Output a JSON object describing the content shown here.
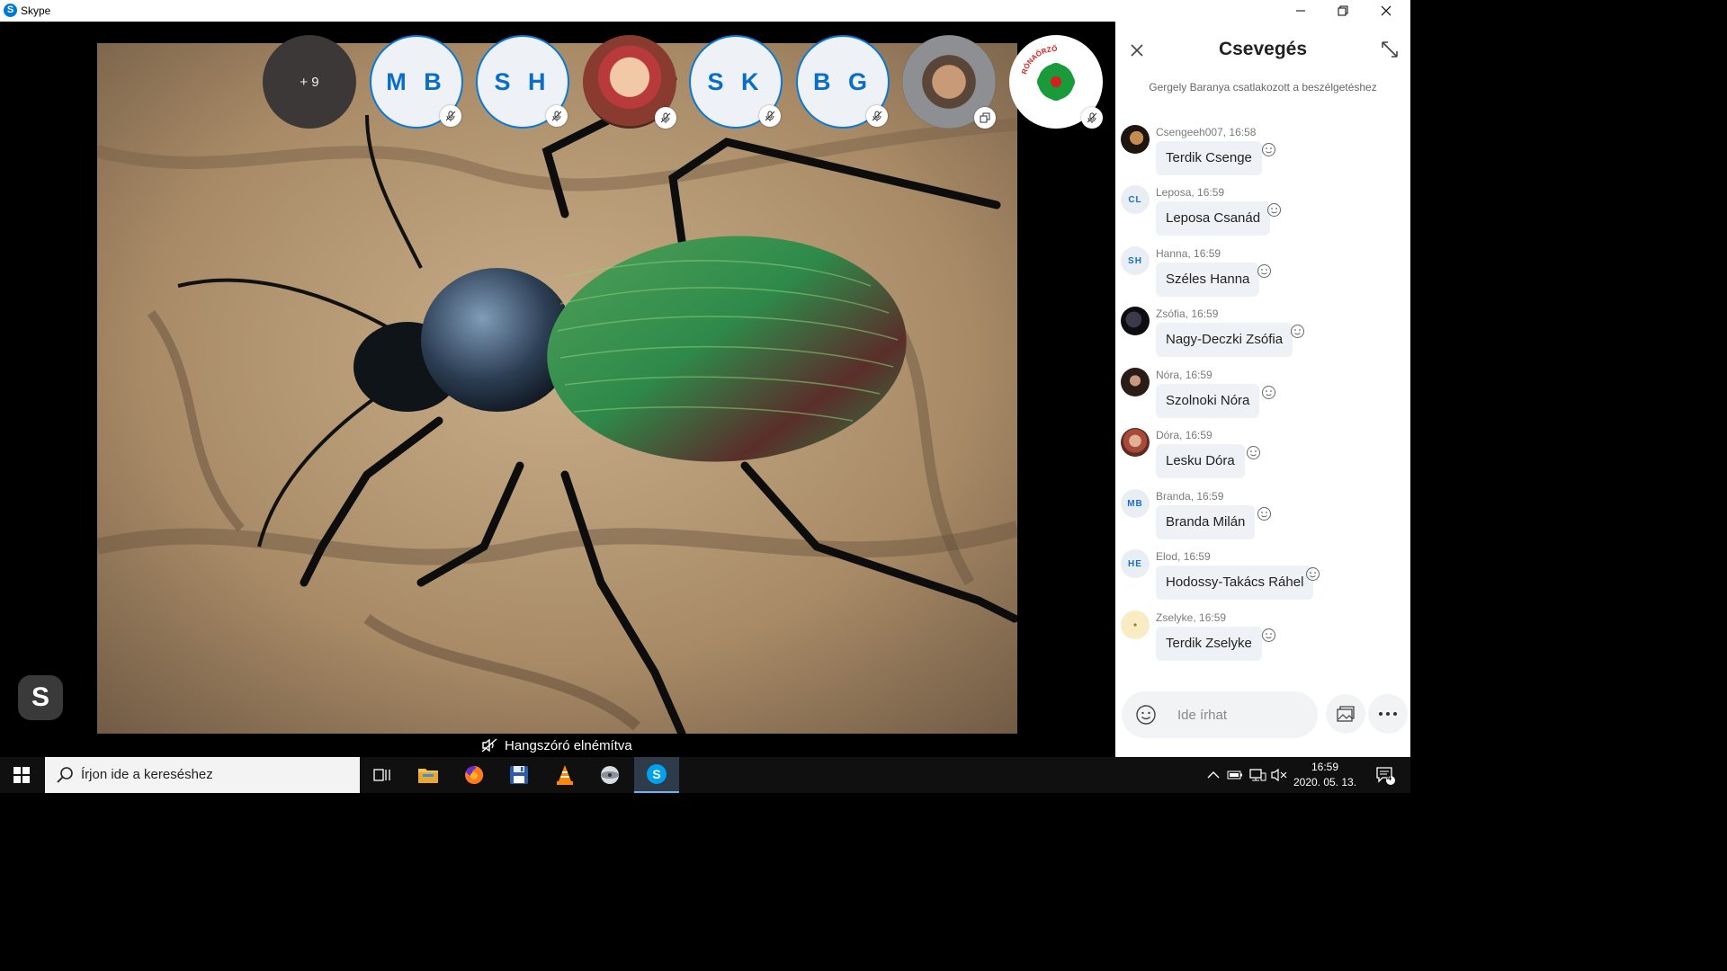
{
  "window": {
    "title": "Skype"
  },
  "call": {
    "participants": [
      {
        "type": "more",
        "label": "+ 9"
      },
      {
        "type": "initials",
        "label": "M B",
        "muted": true
      },
      {
        "type": "initials",
        "label": "S H",
        "muted": true
      },
      {
        "type": "photo",
        "label": "",
        "muted": true
      },
      {
        "type": "initials",
        "label": "S K",
        "muted": true
      },
      {
        "type": "initials",
        "label": "B G",
        "muted": true
      },
      {
        "type": "photo",
        "label": "",
        "screen_share": true
      },
      {
        "type": "logo",
        "label": "RÓNAŐRZŐ TERMÉSZETVÉDELMI EGYESÜLET",
        "muted": true
      }
    ],
    "speaker_status": "Hangszóró elnémítva",
    "colors": {
      "accent": "#0a78d6",
      "stage_bg": "#000000"
    }
  },
  "chat": {
    "title": "Csevegés",
    "system_message": "Gergely Baranya csatlakozott a beszélgetéshez",
    "messages": [
      {
        "author": "Csengeeh007",
        "time": "16:58",
        "text": "Terdik Csenge",
        "avatar": "photo",
        "initials": ""
      },
      {
        "author": "Leposa",
        "time": "16:59",
        "text": "Leposa Csanád",
        "avatar": "initials",
        "initials": "CL"
      },
      {
        "author": "Hanna",
        "time": "16:59",
        "text": "Széles Hanna",
        "avatar": "initials",
        "initials": "SH"
      },
      {
        "author": "Zsófia",
        "time": "16:59",
        "text": "Nagy-Deczki Zsófia",
        "avatar": "photo",
        "initials": ""
      },
      {
        "author": "Nóra",
        "time": "16:59",
        "text": "Szolnoki Nóra",
        "avatar": "photo",
        "initials": ""
      },
      {
        "author": "Dóra",
        "time": "16:59",
        "text": "Lesku Dóra",
        "avatar": "photo",
        "initials": ""
      },
      {
        "author": "Branda",
        "time": "16:59",
        "text": "Branda Milán",
        "avatar": "initials",
        "initials": "MB"
      },
      {
        "author": "Elod",
        "time": "16:59",
        "text": "Hodossy-Takács Ráhel",
        "avatar": "initials",
        "initials": "HE"
      },
      {
        "author": "Zselyke",
        "time": "16:59",
        "text": "Terdik Zselyke",
        "avatar": "dot",
        "initials": ""
      }
    ],
    "composer_placeholder": "Ide írhat"
  },
  "taskbar": {
    "search_placeholder": "Írjon ide a kereséshez",
    "time": "16:59",
    "date": "2020. 05. 13.",
    "notification_count": "4"
  }
}
